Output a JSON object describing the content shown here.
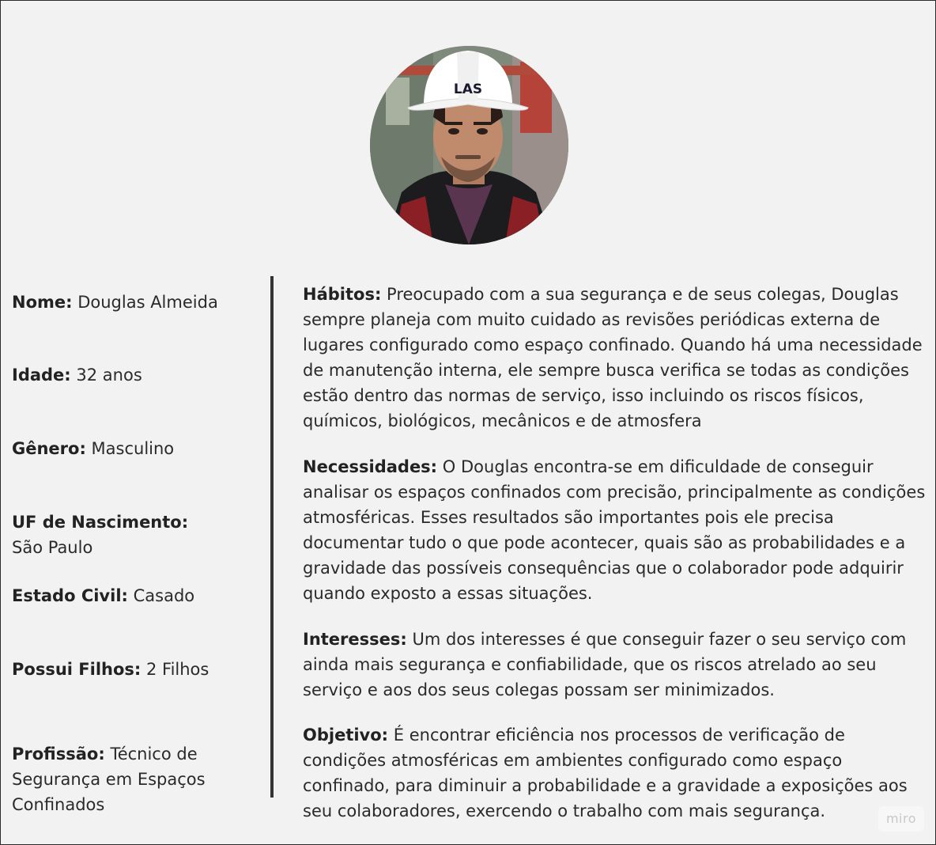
{
  "profile": {
    "avatar_helmet_text": "LAS"
  },
  "fields": {
    "nome": {
      "label": "Nome:",
      "value": "Douglas Almeida"
    },
    "idade": {
      "label": "Idade:",
      "value": "32 anos"
    },
    "genero": {
      "label": "Gênero:",
      "value": "Masculino"
    },
    "uf": {
      "label": "UF de Nascimento:",
      "value": "São Paulo"
    },
    "estado_civil": {
      "label": "Estado Civil:",
      "value": "Casado"
    },
    "filhos": {
      "label": "Possui Filhos:",
      "value": "2 Filhos"
    },
    "profissao": {
      "label": "Profissão:",
      "value": "Técnico de Segurança em Espaços Confinados"
    }
  },
  "sections": {
    "habitos": {
      "label": "Hábitos:",
      "text": "Preocupado com a sua segurança e de seus colegas, Douglas sempre planeja com muito cuidado as revisões periódicas externa de lugares configurado como espaço confinado. Quando há uma necessidade de manutenção interna, ele sempre busca verifica se todas as condições estão dentro das normas de serviço, isso incluindo os riscos físicos, químicos, biológicos, mecânicos e de atmosfera"
    },
    "necessidades": {
      "label": "Necessidades:",
      "text": "O Douglas encontra-se em dificuldade de conseguir analisar os espaços confinados com precisão, principalmente as condições atmosféricas. Esses resultados são importantes pois ele precisa documentar tudo o que pode acontecer, quais são as probabilidades e a gravidade das possíveis consequências que o colaborador pode adquirir quando exposto a essas situações."
    },
    "interesses": {
      "label": "Interesses:",
      "text": "Um dos interesses é que conseguir fazer o seu serviço com ainda mais segurança e confiabilidade, que os riscos atrelado ao seu serviço e aos dos seus colegas possam ser minimizados."
    },
    "objetivo": {
      "label": "Objetivo:",
      "text": "É encontrar eficiência nos processos de verificação de condições atmosféricas em ambientes configurado como espaço confinado, para diminuir a probabilidade e a gravidade a exposições aos seu colaboradores, exercendo o trabalho com mais segurança."
    }
  },
  "watermark": {
    "text": "miro"
  },
  "colors": {
    "background": "#f2f2f2",
    "text": "#2a2a2a",
    "divider": "#333333",
    "helmet": "#ffffff"
  }
}
